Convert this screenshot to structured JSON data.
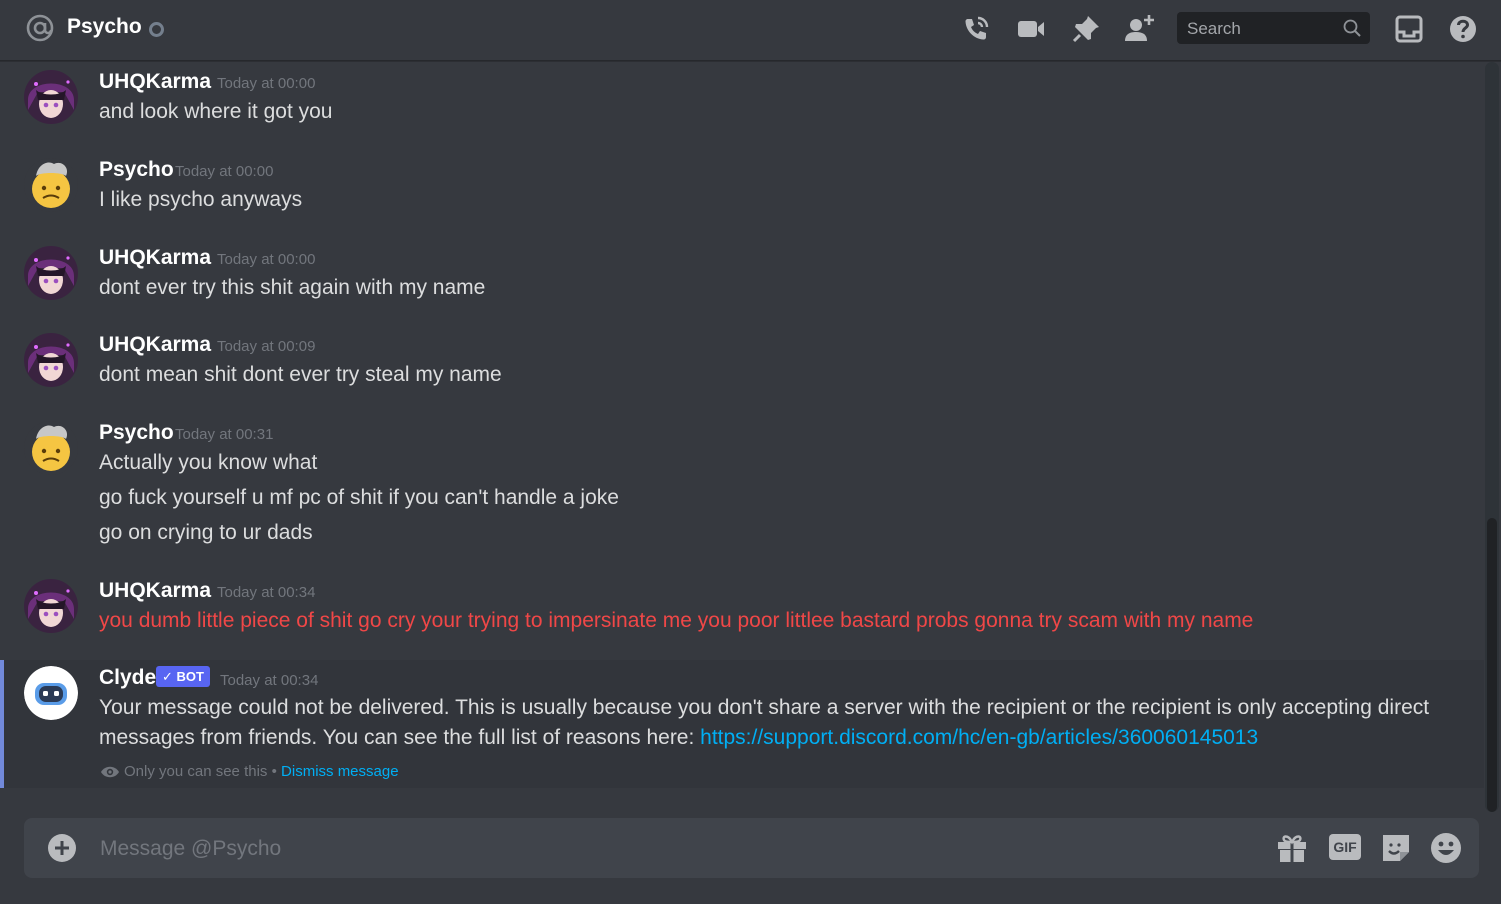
{
  "header": {
    "title": "Psycho",
    "search_placeholder": "Search",
    "icons": [
      "at-icon",
      "start-voice-call-icon",
      "start-video-call-icon",
      "pinned-messages-icon",
      "add-friends-icon",
      "search-icon",
      "inbox-icon",
      "help-icon"
    ]
  },
  "messages": [
    {
      "author": "UHQKarma",
      "timestamp": "Today at 00:00",
      "lines": [
        "and look where it got you"
      ]
    },
    {
      "author": "Psycho",
      "timestamp": "Today at 00:00",
      "lines": [
        "I like psycho anyways"
      ]
    },
    {
      "author": "UHQKarma",
      "timestamp": "Today at 00:00",
      "lines": [
        "dont ever try this shit again with my name"
      ]
    },
    {
      "author": "UHQKarma",
      "timestamp": "Today at 00:09",
      "lines": [
        "dont mean shit dont ever try steal my name"
      ]
    },
    {
      "author": "Psycho",
      "timestamp": "Today at 00:31",
      "lines": [
        "Actually you know what",
        "go fuck yourself u mf pc of shit if you can't handle a joke",
        "go on crying to ur dads"
      ]
    },
    {
      "author": "UHQKarma",
      "timestamp": "Today at 00:34",
      "lines": [
        "you dumb little piece of shit go cry your trying to impersinate me you poor littlee bastard probs gonna try scam with my name"
      ],
      "failed": true
    }
  ],
  "clyde": {
    "author": "Clyde",
    "bot_tag": "BOT",
    "timestamp": "Today at 00:34",
    "line1": "Your message could not be delivered. This is usually because you don't share a server with the recipient or the recipient is only accepting direct",
    "line2_prefix": "messages from friends. You can see the full list of reasons here: ",
    "link": "https://support.discord.com/hc/en-gb/articles/360060145013",
    "ephemeral_note": "Only you can see this",
    "separator": "•",
    "dismiss_label": "Dismiss message"
  },
  "composer": {
    "placeholder": "Message @Psycho",
    "gif_label": "GIF",
    "icons": [
      "plus-icon",
      "gift-icon",
      "gif-icon",
      "sticker-icon",
      "emoji-icon"
    ]
  },
  "colors": {
    "background": "#36393f",
    "failed_text": "#f04747",
    "link": "#00aff4",
    "bot_tag": "#5865f2",
    "ephemeral_border": "#7289da"
  }
}
